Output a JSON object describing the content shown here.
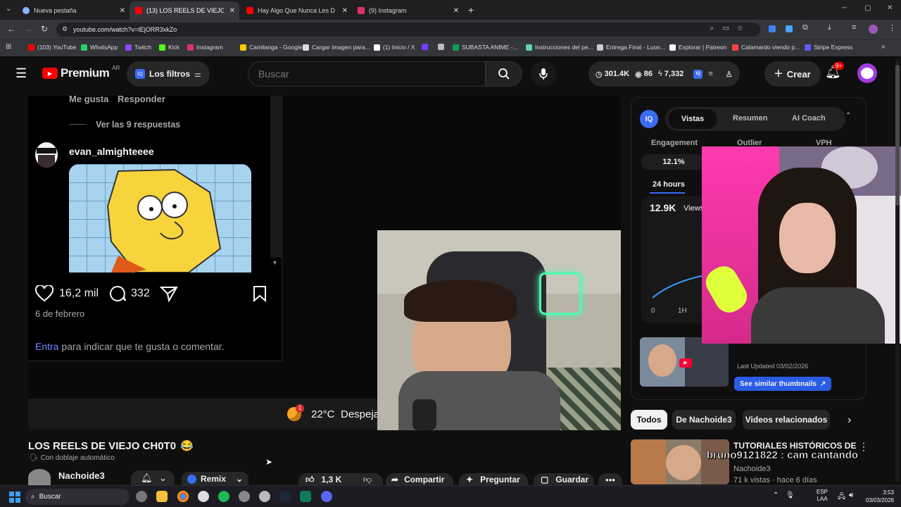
{
  "browser": {
    "tabs": [
      {
        "label": "Nueva pestaña",
        "color": "#8ab4f8"
      },
      {
        "label": "(13) LOS REELS DE VIEJO C",
        "color": "#ff0000"
      },
      {
        "label": "Hay Algo Que Nunca Les Dije",
        "color": "#ff0000"
      },
      {
        "label": "(9) Instagram",
        "color": "#e1306c"
      }
    ],
    "new_tab": "+",
    "url": "youtube.com/watch?v=tEjORR3xkZo",
    "bookmarks": [
      {
        "label": "(103) YouTube",
        "color": "#ff0000"
      },
      {
        "label": "WhatsApp",
        "color": "#25d366"
      },
      {
        "label": "Twitch",
        "color": "#9146ff"
      },
      {
        "label": "Kick",
        "color": "#53fc18"
      },
      {
        "label": "Instagram",
        "color": "#e1306c"
      },
      {
        "label": "Camilanga - Google...",
        "color": "#ffcc00"
      },
      {
        "label": "Cargar imagen para...",
        "color": "#dddddd"
      },
      {
        "label": "(1) Inicio / X",
        "color": "#ffffff"
      },
      {
        "label": "",
        "color": "#7a3cff"
      },
      {
        "label": "",
        "color": "#bbbbbb"
      },
      {
        "label": "SUBASTA ANIME -...",
        "color": "#0f9d58"
      },
      {
        "label": "Instrucciones del pe...",
        "color": "#5fd3b5"
      },
      {
        "label": "Entrega Final - Luon...",
        "color": "#cccccc"
      },
      {
        "label": "Explorar | Patreon",
        "color": "#ffffff"
      },
      {
        "label": "Calamardo viendo p...",
        "color": "#ff4444"
      },
      {
        "label": "Stripe Express",
        "color": "#635bff"
      }
    ]
  },
  "youtube": {
    "logo": "Premium",
    "region": "AR",
    "filters": "Los filtros",
    "search_placeholder": "Buscar",
    "stats": {
      "subs": "301.4K",
      "views": "86",
      "other": "7,332"
    },
    "create": "Crear",
    "notif_badge": "9+"
  },
  "comments": {
    "like": "Me gusta",
    "reply": "Responder",
    "replies": "Ver las 9 respuestas",
    "user": "evan_almighteeee",
    "likes": "16,2 mil",
    "comments": "332",
    "date": "6 de febrero",
    "login_link": "Entra",
    "login_text": "para indicar que te gusta o comentar."
  },
  "weather": {
    "temp": "22°C",
    "desc": "Despeja",
    "badge": "1"
  },
  "video": {
    "title": "LOS REELS DE VIEJO CH0T0",
    "emoji": "😂",
    "dub": "Con doblaje automático",
    "channel": "Nachoide3",
    "remix": "Remix",
    "likes": "1,3 K",
    "share": "Compartir",
    "ask": "Preguntar",
    "save": "Guardar"
  },
  "panel": {
    "tab_views": "Vistas",
    "tab_summary": "Resumen",
    "tab_coach": "AI Coach",
    "col1": "Engagement",
    "col2": "Outlier",
    "col3": "VPH",
    "engagement": "12.1%",
    "period": "24 hours",
    "views_value": "12.9K",
    "views_label": "Views",
    "axis0": "0",
    "axis1": "1H",
    "updated": "Last Updated 03/02/2026",
    "similar": "See similar thumbnails"
  },
  "chips": [
    "Todos",
    "De Nachoide3",
    "Videos relacionados"
  ],
  "rec": {
    "title": "TUTORIALES HISTÓRICOS DE",
    "overlay": "bruno9121822 : cam cantando",
    "channel": "Nachoide3",
    "meta": "71 k vistas · hace 6 días"
  },
  "taskbar": {
    "search": "Buscar",
    "lang1": "ESP",
    "lang2": "LAA",
    "time": "3:53",
    "date": "03/03/2026"
  }
}
